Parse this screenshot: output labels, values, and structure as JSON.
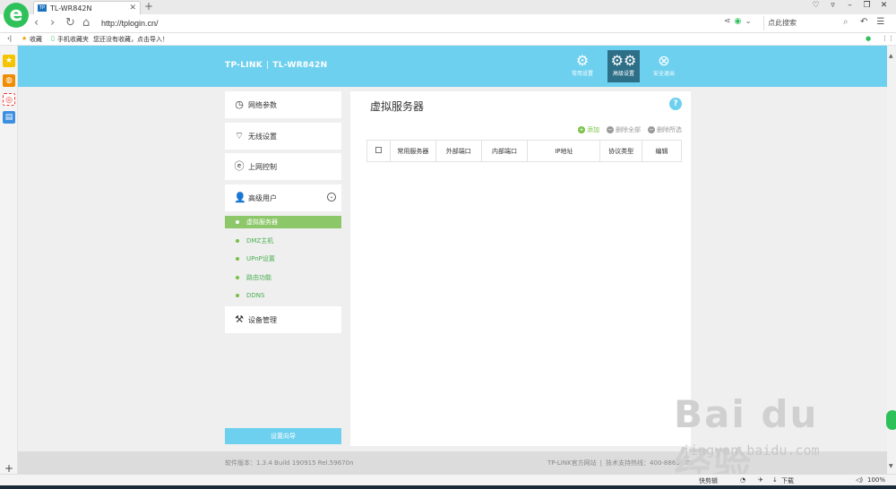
{
  "browser": {
    "tab_title": "TL-WR842N",
    "tab_favicon_text": "TP",
    "url": "http://tplogin.cn/",
    "search_placeholder": "点此搜索",
    "favorites_label": "收藏",
    "mobile_favorites_label": "手机收藏夹",
    "favbar_hint": "您还没有收藏，点击导入！",
    "zoom": "100%",
    "quick_cut": "快剪辑",
    "download": "下载"
  },
  "router": {
    "brand": "TP-LINK",
    "model": "TL-WR842N",
    "top_buttons": [
      {
        "label": "常用设置",
        "icon": "gear-icon"
      },
      {
        "label": "高级设置",
        "icon": "gears-icon"
      },
      {
        "label": "安全退出",
        "icon": "exit-icon"
      }
    ],
    "menu": [
      {
        "label": "网络参数",
        "icon": "network-icon"
      },
      {
        "label": "无线设置",
        "icon": "wifi-icon"
      },
      {
        "label": "上网控制",
        "icon": "internet-control-icon"
      },
      {
        "label": "高级用户",
        "icon": "user-icon"
      },
      {
        "label": "设备管理",
        "icon": "tools-icon"
      }
    ],
    "submenu": [
      "虚拟服务器",
      "DMZ主机",
      "UPnP设置",
      "路由功能",
      "DDNS"
    ],
    "wizard_label": "设置向导",
    "content_title": "虚拟服务器",
    "help_label": "?",
    "actions": {
      "add": "添加",
      "delete_all": "删除全部",
      "delete_selected": "删除所选"
    },
    "table_headers": [
      "常用服务器",
      "外部端口",
      "内部端口",
      "IP地址",
      "协议类型",
      "编辑"
    ],
    "footer_version": "软件版本：1.3.4 Build 190915 Rel.59670n",
    "footer_site": "TP-LINK官方网站",
    "footer_hotline": "技术支持热线：400-8863-400"
  },
  "watermark": {
    "logo": "Bai du 经验",
    "url": "jingyan.baidu.com"
  },
  "colors": {
    "header": "#6dd0ee",
    "active_top": "#2d6f87",
    "submenu_active": "#8cc769",
    "add_green": "#76c043"
  }
}
